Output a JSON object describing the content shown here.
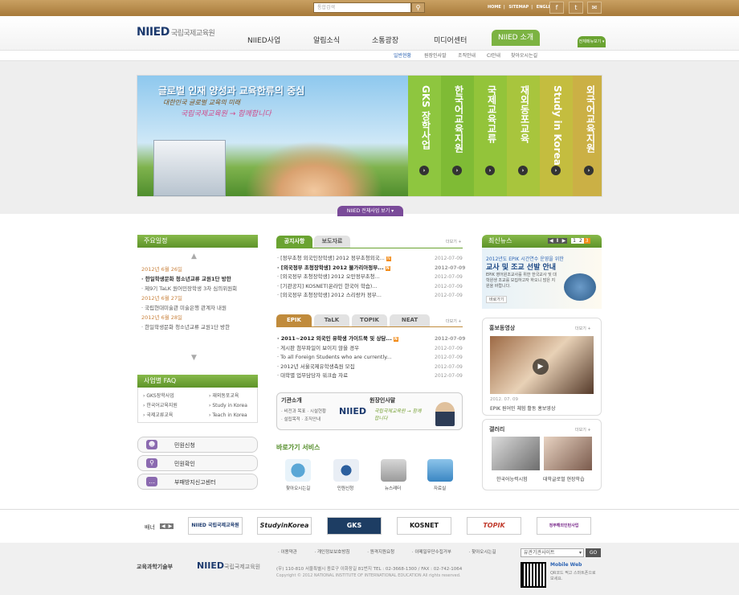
{
  "top": {
    "search_placeholder": "통합검색",
    "links": [
      "HOME",
      "SITEMAP",
      "ENGLISH"
    ],
    "sns": [
      "f",
      "t",
      "✉"
    ]
  },
  "logo": {
    "mark": "NIIED",
    "name": "국립국제교육원"
  },
  "nav": [
    "NIIED사업",
    "알림소식",
    "소통광장",
    "미디어센터",
    "NIIED 소개"
  ],
  "menu_btn": "전체메뉴보기 ▾",
  "subnav": [
    "일반현황",
    "원장인사말",
    "조직안내",
    "CI안내",
    "찾아오시는길"
  ],
  "hero": {
    "title": "글로벌 인재 양성과 교육한류의 중심",
    "sub1": "대한민국 글로벌 교육의 미래",
    "sub2": "국립국제교육원 → 함께합니다",
    "tabs": [
      "GKS 장학사업",
      "한국어교육지원",
      "국제교육교류",
      "재외동포교육",
      "Study in Korea",
      "외국어교육지원"
    ],
    "btn": "NIIED 전체사업 보기 ▾"
  },
  "schedule": {
    "title": "주요일정",
    "items": [
      {
        "date": "2012년 6월 26일",
        "text": "· 한일학생문화 청소년교류 교원1단 방한"
      },
      {
        "date": "",
        "text": "· 제9기 TaLK 원어민장학생 3차 심의위원회"
      },
      {
        "date": "2012년 6월 27일",
        "text": "· 국립현대미술관 미술은행 관계자 내원"
      },
      {
        "date": "2012년 6월 28일",
        "text": "· 한일학생문화 청소년교류 교원1단 방한"
      }
    ]
  },
  "faq": {
    "title": "사업별 FAQ",
    "left": [
      "GKS장학사업",
      "한국어교육지원",
      "국제교류교육"
    ],
    "right": [
      "재외동포교육",
      "Study in Korea",
      "Teach in Korea"
    ]
  },
  "civil": [
    "민원신청",
    "민원확인",
    "부패방지신고센터"
  ],
  "notice": {
    "tabs": [
      "공지사항",
      "보도자료"
    ],
    "more": "더보기 +",
    "items": [
      {
        "t": "[정부초청 외국인장학생] 2012 정부초청외국...",
        "d": "2012-07-09",
        "n": true
      },
      {
        "t": "[외국정부 초청장학생] 2012 불가리아정부...",
        "d": "2012-07-09",
        "n": true
      },
      {
        "t": "[외국정부 초청장학생] 2012 오만정부초청...",
        "d": "2012-07-09",
        "n": false
      },
      {
        "t": "[기관공지] KOSNET(온라인 한국어 학습)...",
        "d": "2012-07-09",
        "n": false
      },
      {
        "t": "[외국정부 초청장학생] 2012 스리랑카 정부...",
        "d": "2012-07-09",
        "n": false
      }
    ]
  },
  "epik": {
    "tabs": [
      "EPIK",
      "TaLK",
      "TOPIK",
      "NEAT"
    ],
    "more": "더보기 +",
    "items": [
      {
        "t": "2011~2012 외국인 유학생 가이드북 및 상담...",
        "d": "2012-07-09",
        "n": true
      },
      {
        "t": "게시판 첨부파일이 보이지 않을 경우",
        "d": "2012-07-09",
        "n": false
      },
      {
        "t": "To all Foreign Students who are currently...",
        "d": "2012-07-09",
        "n": false
      },
      {
        "t": "2012년 서울국제유학생축원 모집",
        "d": "2012-07-09",
        "n": false
      },
      {
        "t": "대학별 업무담당자 워크숍 자료",
        "d": "2012-07-09",
        "n": false
      }
    ]
  },
  "intro": {
    "title": "기관소개",
    "items": [
      "비전과 목표",
      "시설현황",
      "설립목적",
      "조직안내"
    ],
    "greet_title": "원장인사말",
    "greet_text": "국립국제교육원 → 함께합니다"
  },
  "quick": {
    "title": "바로가기 서비스",
    "items": [
      "찾아오시는길",
      "민원신청",
      "뉴스레터",
      "자료실"
    ]
  },
  "latest": {
    "title": "최신뉴스",
    "pages": [
      "1",
      "2",
      "3"
    ],
    "headline1": "2012년도 EPIK 시간연수 운영을 위한",
    "headline2": "교사 및 조교 선발 안내",
    "body": "EPIK 영어원조교사를 위한 한국교사 및 대학원생 조교를 모집하고자 하오니 많은 지원을 바랍니다.",
    "btn": "바로가기"
  },
  "video": {
    "title": "홍보동영상",
    "more": "더보기 +",
    "date": "2012. 07. 09",
    "caption": "EPIK 원어민 체험 활동 홍보영상"
  },
  "gallery": {
    "title": "갤러리",
    "more": "더보기 +",
    "items": [
      "한국어능력시험",
      "대학글로벌 현장학습"
    ]
  },
  "banners": {
    "label": "배너",
    "items": [
      "NIIED 국립국제교육원",
      "StudyinKorea",
      "GKS",
      "KOSNET",
      "TOPIK",
      "정부해외인턴사업"
    ]
  },
  "footer": {
    "links": [
      "이용약관",
      "개인정보보호방침",
      "원격지원요청",
      "이메일무단수집거부",
      "찾아오시는길"
    ],
    "addr": "(우) 110-810 서울특별시 종로구 이화장길 81번지    TEL : 02-3668-1300    /    FAX : 02-742-1064",
    "copy": "Copyright © 2012 NATIONAL INSTITUTE OF INTERNATIONAL EDUCATION All rights reserved.",
    "select": "유관기관사이트",
    "go": "GO",
    "mobile": "Mobile Web",
    "mobile_text": "QR코드 찍고 스마트폰으로 보세요.",
    "ministry": "교육과학기술부"
  }
}
